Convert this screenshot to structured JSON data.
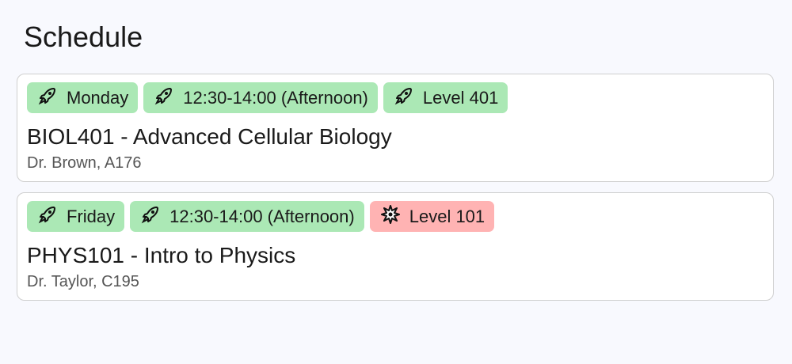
{
  "header": {
    "title": "Schedule"
  },
  "colors": {
    "green": "#abe8b5",
    "red": "#ffb3b3"
  },
  "courses": [
    {
      "badges": [
        {
          "icon": "rocket-icon",
          "label": "Monday",
          "color": "green"
        },
        {
          "icon": "rocket-icon",
          "label": "12:30-14:00 (Afternoon)",
          "color": "green"
        },
        {
          "icon": "rocket-icon",
          "label": "Level 401",
          "color": "green"
        }
      ],
      "title": "BIOL401 - Advanced Cellular Biology",
      "subtitle": "Dr. Brown, A176"
    },
    {
      "badges": [
        {
          "icon": "rocket-icon",
          "label": "Friday",
          "color": "green"
        },
        {
          "icon": "rocket-icon",
          "label": "12:30-14:00 (Afternoon)",
          "color": "green"
        },
        {
          "icon": "collision-icon",
          "label": "Level 101",
          "color": "red"
        }
      ],
      "title": "PHYS101 - Intro to Physics",
      "subtitle": "Dr. Taylor, C195"
    }
  ]
}
